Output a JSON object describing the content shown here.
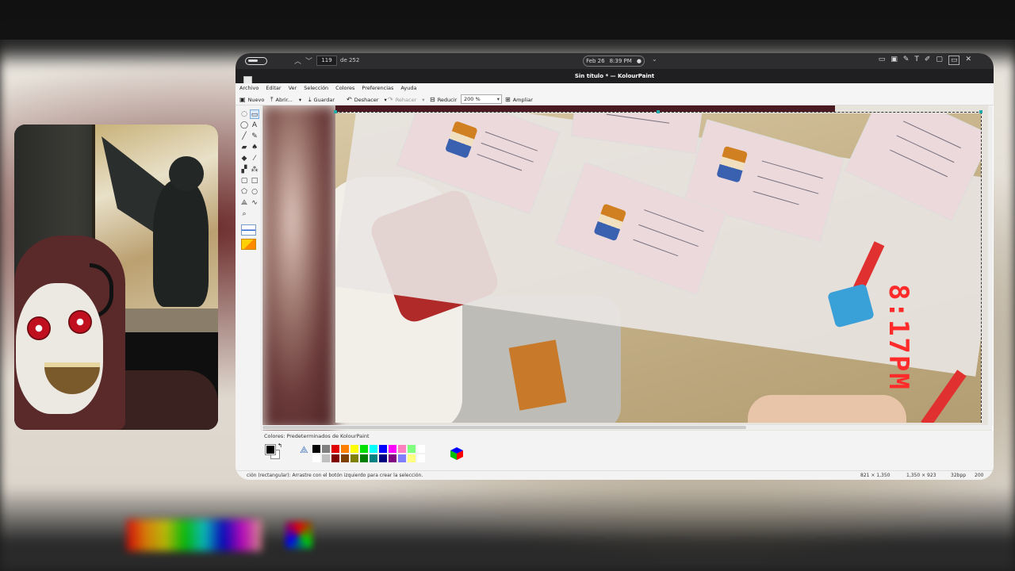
{
  "taskbar": {
    "page_current": "119",
    "page_of": "de 252",
    "date": "Feb 26",
    "time": "8:39 PM",
    "icons": [
      "comment-icon",
      "image-icon",
      "pen-icon",
      "text-icon",
      "highlight-icon",
      "crop-icon",
      "fullscreen-icon",
      "close-icon"
    ]
  },
  "window": {
    "title": "Sin título * — KolourPaint"
  },
  "menu": [
    "Archivo",
    "Editar",
    "Ver",
    "Selección",
    "Colores",
    "Preferencias",
    "Ayuda"
  ],
  "toolbar": {
    "new_label": "Nuevo",
    "open_label": "Abrir...",
    "save_label": "Guardar",
    "undo_label": "Deshacer",
    "redo_label": "Rehacer",
    "zoom_out_label": "Reducir",
    "zoom_value": "200 %",
    "zoom_in_label": "Ampliar"
  },
  "canvas": {
    "timestamp_text": "8:17PM"
  },
  "palette": {
    "label": "Colores: Predeterminados de KolourPaint",
    "foreground": "#000000",
    "background": "#ffffff",
    "swatches_top": [
      "#000000",
      "#808080",
      "#e00000",
      "#ff8000",
      "#ffff00",
      "#00e000",
      "#00ffff",
      "#0000ff",
      "#ff00ff",
      "#ff80c0",
      "#80ff80",
      "#ffffff"
    ],
    "swatches_bottom": [
      "#ffffff",
      "#c0c0c0",
      "#800000",
      "#804000",
      "#808000",
      "#008000",
      "#008080",
      "#000080",
      "#800080",
      "#8080ff",
      "#ffff80",
      "#ffffff"
    ]
  },
  "status": {
    "message": "ción (rectangular): Arrastre con el botón izquierdo para crear la selección.",
    "cursor": "821 × 1,350",
    "size": "1,350 × 923",
    "depth": "32bpp",
    "zoom": "200"
  }
}
